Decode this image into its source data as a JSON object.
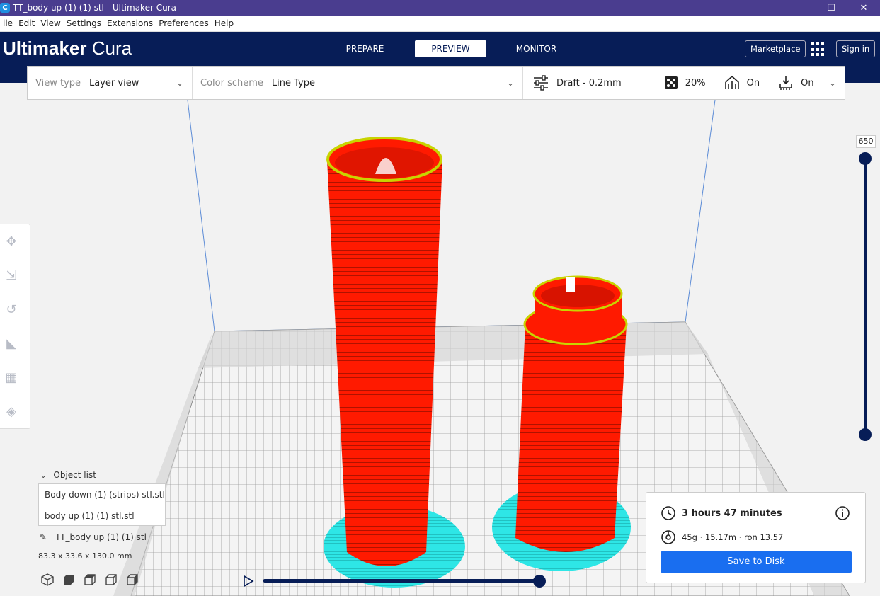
{
  "window": {
    "title": "TT_body up  (1) (1) stl - Ultimaker Cura",
    "icon": "cura-icon"
  },
  "menu": [
    "ile",
    "Edit",
    "View",
    "Settings",
    "Extensions",
    "Preferences",
    "Help"
  ],
  "header": {
    "brand_bold": "Ultimaker",
    "brand_light": " Cura",
    "tabs": [
      {
        "label": "PREPARE",
        "active": false
      },
      {
        "label": "PREVIEW",
        "active": true
      },
      {
        "label": "MONITOR",
        "active": false
      }
    ],
    "marketplace_label": "Marketplace",
    "signin_label": "Sign in"
  },
  "toolbar": {
    "view_type_label": "View type",
    "view_type_value": "Layer view",
    "color_scheme_label": "Color scheme",
    "color_scheme_value": "Line Type",
    "profile": "Draft - 0.2mm",
    "infill": "20%",
    "support": "On",
    "adhesion": "On"
  },
  "layer_slider": {
    "current_layer": "650",
    "upper_fraction": 1.0,
    "lower_fraction": 0.0
  },
  "objects": {
    "header": "Object list",
    "items": [
      "Body down (1) (strips) stl.stl",
      "body up  (1) (1) stl.stl"
    ],
    "selected_name": "TT_body up  (1) (1) stl",
    "dimensions": "83.3 x 33.6 x 130.0 mm"
  },
  "simulation": {
    "progress": 1.0
  },
  "print_info": {
    "time": "3 hours 47 minutes",
    "material": "45g · 15.17m · ron 13.57",
    "save_label": "Save to Disk"
  },
  "colors": {
    "header_bg": "#071d57",
    "titlebar_bg": "#4a3d8f",
    "accent_blue": "#196ef0",
    "wall_red": "#ff1a00",
    "skirt_cyan": "#2ee6e6",
    "top_yellow": "#e8f000"
  }
}
